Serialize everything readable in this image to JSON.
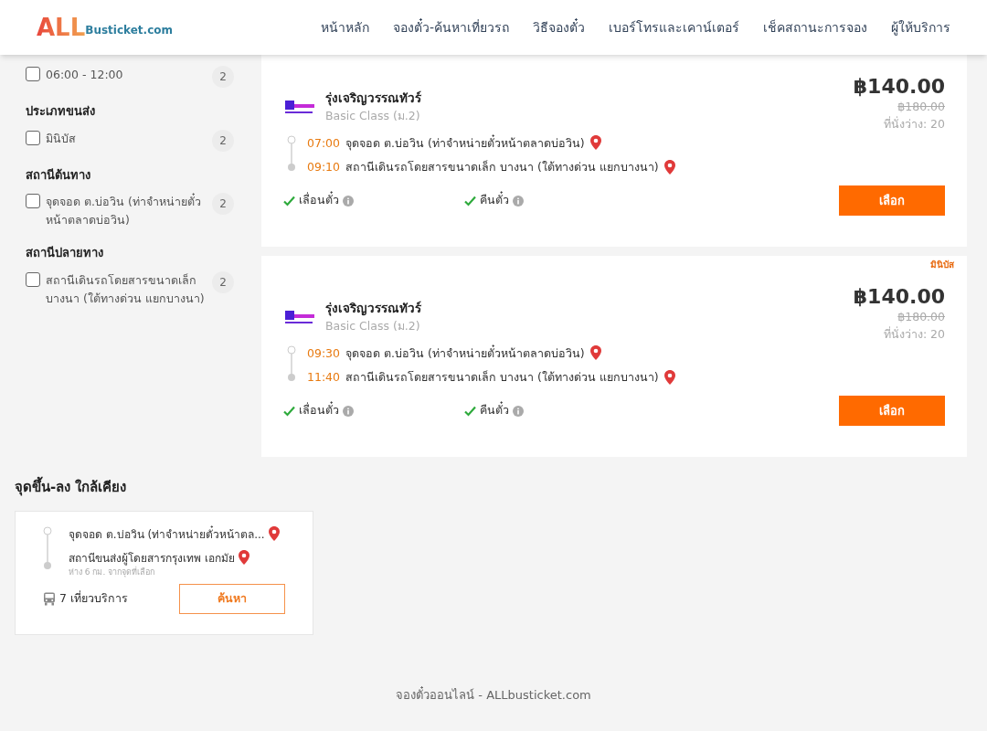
{
  "header": {
    "logo": {
      "part_1": "ALL",
      "part_2": "Busticket.com"
    },
    "nav": [
      {
        "label": "หน้าหลัก"
      },
      {
        "label": "จองตั๋ว-ค้นหาเที่ยวรถ"
      },
      {
        "label": "วิธีจองตั๋ว"
      },
      {
        "label": "เบอร์โทรและเคาน์เตอร์"
      },
      {
        "label": "เช็คสถานะการจอง"
      },
      {
        "label": "ผู้ให้บริการ"
      }
    ]
  },
  "filters": [
    {
      "items": [
        {
          "label": "06:00 - 12:00",
          "count": "2",
          "checked": false
        }
      ]
    },
    {
      "title": "ประเภทขนส่ง",
      "items": [
        {
          "label": "มินิบัส",
          "count": "2",
          "checked": false
        }
      ]
    },
    {
      "title": "สถานีต้นทาง",
      "items": [
        {
          "label": "จุดจอด ต.บ่อวิน (ท่าจำหน่ายตั๋วหน้าตลาดบ่อวิน)",
          "count": "2",
          "checked": false
        }
      ]
    },
    {
      "title": "สถานีปลายทาง",
      "items": [
        {
          "label": "สถานีเดินรถโดยสารขนาดเล็ก บางนา (ใต้ทางด่วน แยกบางนา)",
          "count": "2",
          "checked": false
        }
      ]
    }
  ],
  "trips": [
    {
      "operator": "รุ่งเจริญวรรณทัวร์",
      "class": "Basic Class (ม.2)",
      "price": "฿140.00",
      "old_price": "฿180.00",
      "seats": "ที่นั่งว่าง: 20",
      "departure": {
        "time": "07:00",
        "place": "จุดจอด ต.บ่อวิน (ท่าจำหน่ายตั๋วหน้าตลาดบ่อวิน)"
      },
      "arrival": {
        "time": "09:10",
        "place": "สถานีเดินรถโดยสารขนาดเล็ก บางนา (ใต้ทางด่วน แยกบางนา)"
      },
      "features": [
        {
          "label": "เลื่อนตั๋ว",
          "available": true
        },
        {
          "label": "คืนตั๋ว",
          "available": true
        }
      ],
      "button": "เลือก"
    },
    {
      "badge": "มินิบัส",
      "operator": "รุ่งเจริญวรรณทัวร์",
      "class": "Basic Class (ม.2)",
      "price": "฿140.00",
      "old_price": "฿180.00",
      "seats": "ที่นั่งว่าง: 20",
      "departure": {
        "time": "09:30",
        "place": "จุดจอด ต.บ่อวิน (ท่าจำหน่ายตั๋วหน้าตลาดบ่อวิน)"
      },
      "arrival": {
        "time": "11:40",
        "place": "สถานีเดินรถโดยสารขนาดเล็ก บางนา (ใต้ทางด่วน แยกบางนา)"
      },
      "features": [
        {
          "label": "เลื่อนตั๋ว",
          "available": true
        },
        {
          "label": "คืนตั๋ว",
          "available": true
        }
      ],
      "button": "เลือก"
    }
  ],
  "nearby": {
    "title": "จุดขึ้น-ลง ใกล้เคียง",
    "cards": [
      {
        "from": "จุดจอด ต.บ่อวิน (ท่าจำหน่ายตั๋วหน้าตล...",
        "to": "สถานีขนส่งผู้โดยสารกรุงเทพ เอกมัย",
        "distance": "ห่าง 6 กม. จากจุดที่เลือก",
        "trips": "7 เที่ยวบริการ",
        "button": "ค้นหา"
      }
    ]
  },
  "footer": {
    "text": "จองตั๋วออนไลน์ - ALLbusticket.com"
  }
}
